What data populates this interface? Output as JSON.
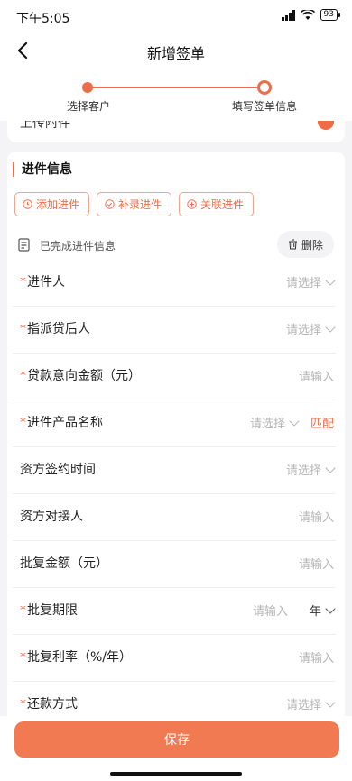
{
  "status": {
    "time": "下午5:05",
    "battery": "93"
  },
  "nav": {
    "title": "新增签单"
  },
  "steps": [
    {
      "label": "选择客户"
    },
    {
      "label": "填写签单信息"
    }
  ],
  "prev_section": {
    "label": "上传附件"
  },
  "section": {
    "title": "进件信息",
    "buttons": [
      {
        "label": "添加进件"
      },
      {
        "label": "补录进件"
      },
      {
        "label": "关联进件"
      }
    ],
    "done_text": "已完成进件信息",
    "delete_label": "删除"
  },
  "fields": [
    {
      "label": "进件人",
      "required": "*",
      "placeholder": "请选择"
    },
    {
      "label": "指派贷后人",
      "required": "*",
      "placeholder": "请选择"
    },
    {
      "label": "贷款意向金额（元）",
      "required": "*",
      "placeholder": "请输入"
    },
    {
      "label": "进件产品名称",
      "required": "*",
      "placeholder": "请选择",
      "action": "匹配"
    },
    {
      "label": "资方签约时间",
      "placeholder": "请选择"
    },
    {
      "label": "资方对接人",
      "placeholder": "请输入"
    },
    {
      "label": "批复金额（元）",
      "placeholder": "请输入"
    },
    {
      "label": "批复期限",
      "required": "*",
      "placeholder": "请输入",
      "unit": "年"
    },
    {
      "label": "批复利率（%/年）",
      "required": "*",
      "placeholder": "请输入"
    },
    {
      "label": "还款方式",
      "required": "*",
      "placeholder": "请选择"
    }
  ],
  "footer": {
    "save_label": "保存"
  },
  "colors": {
    "accent": "#f06c47",
    "save_button": "#f27a52"
  }
}
